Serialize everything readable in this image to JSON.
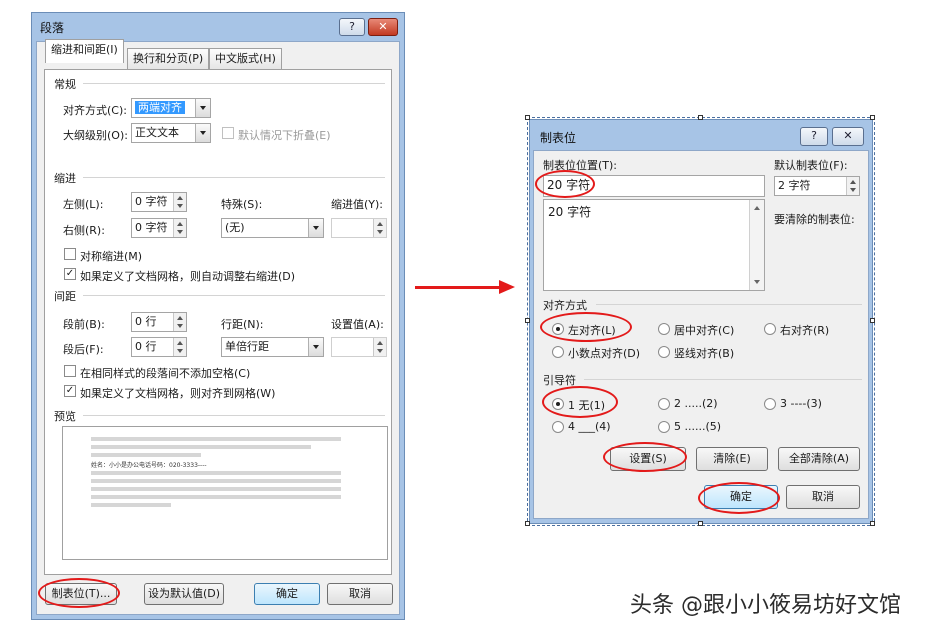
{
  "paragraph_dialog": {
    "title": "段落",
    "help_glyph": "?",
    "close_glyph": "✕",
    "tabs": [
      "缩进和间距(I)",
      "换行和分页(P)",
      "中文版式(H)"
    ],
    "general": {
      "section": "常规",
      "alignment_label": "对齐方式(C):",
      "alignment_value": "两端对齐",
      "outline_label": "大纲级别(O):",
      "outline_value": "正文文本",
      "collapse_label": "默认情况下折叠(E)"
    },
    "indent": {
      "section": "缩进",
      "left_label": "左侧(L):",
      "left_value": "0 字符",
      "right_label": "右侧(R):",
      "right_value": "0 字符",
      "special_label": "特殊(S):",
      "special_value": "(无)",
      "by_label": "缩进值(Y):",
      "mirror_label": "对称缩进(M)",
      "auto_adjust_label": "如果定义了文档网格，则自动调整右缩进(D)"
    },
    "spacing": {
      "section": "间距",
      "before_label": "段前(B):",
      "before_value": "0 行",
      "after_label": "段后(F):",
      "after_value": "0 行",
      "line_label": "行距(N):",
      "line_value": "单倍行距",
      "at_label": "设置值(A):",
      "no_space_label": "在相同样式的段落间不添加空格(C)",
      "snap_grid_label": "如果定义了文档网格，则对齐到网格(W)"
    },
    "preview": {
      "section": "预览",
      "sample_text": "姓名：小小是办公电话号码：020-3333----"
    },
    "buttons": {
      "tabs": "制表位(T)...",
      "set_default": "设为默认值(D)",
      "ok": "确定",
      "cancel": "取消"
    },
    "checked": "✓"
  },
  "tabs_dialog": {
    "title": "制表位",
    "help_glyph": "?",
    "close_glyph": "✕",
    "tab_stop_label": "制表位位置(T):",
    "tab_stop_value": "20 字符",
    "tab_list": [
      "20 字符"
    ],
    "default_label": "默认制表位(F):",
    "default_value": "2 字符",
    "to_clear_label": "要清除的制表位:",
    "alignment": {
      "title": "对齐方式",
      "options": [
        "左对齐(L)",
        "居中对齐(C)",
        "右对齐(R)",
        "小数点对齐(D)",
        "竖线对齐(B)"
      ],
      "selected": "左对齐(L)"
    },
    "leader": {
      "title": "引导符",
      "options": [
        "1 无(1)",
        "2 .....(2)",
        "3 ----(3)",
        "4 ___(4)",
        "5 ......(5)"
      ],
      "selected": "1 无(1)"
    },
    "buttons": {
      "set": "设置(S)",
      "clear": "清除(E)",
      "clear_all": "全部清除(A)",
      "ok": "确定",
      "cancel": "取消"
    }
  },
  "watermark": "头条 @跟小小筱易坊好文馆",
  "colors": {
    "annotation": "#e31a1a",
    "titlebar": "#a7c4e6",
    "selection": "#3399ff"
  }
}
